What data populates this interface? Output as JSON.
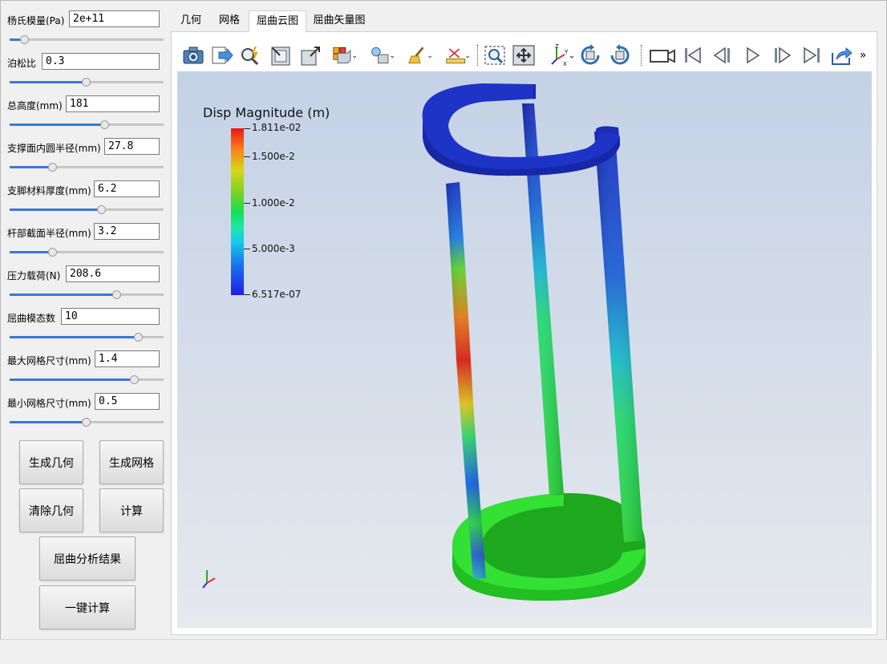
{
  "params": [
    {
      "label": "杨氏模量(Pa)",
      "value": "2e+11",
      "slider": 0.1
    },
    {
      "label": "泊松比",
      "value": "0.3",
      "slider": 0.5
    },
    {
      "label": "总高度(mm)",
      "value": "181",
      "slider": 0.62
    },
    {
      "label": "支撑面内圆半径(mm)",
      "value": "27.8",
      "slider": 0.28
    },
    {
      "label": "支脚材料厚度(mm)",
      "value": "6.2",
      "slider": 0.6
    },
    {
      "label": "杆部截面半径(mm)",
      "value": "3.2",
      "slider": 0.28
    },
    {
      "label": "压力载荷(N)",
      "value": "208.6",
      "slider": 0.7
    },
    {
      "label": "屈曲模态数",
      "value": "10",
      "slider": 0.84
    },
    {
      "label": "最大网格尺寸(mm)",
      "value": "1.4",
      "slider": 0.81
    },
    {
      "label": "最小网格尺寸(mm)",
      "value": "0.5",
      "slider": 0.5
    }
  ],
  "buttons": {
    "gen_geometry": "生成几何",
    "gen_mesh": "生成网格",
    "clear_geometry": "清除几何",
    "compute": "计算",
    "buckling_result": "屈曲分析结果",
    "one_click": "一键计算"
  },
  "tabs": [
    {
      "label": "几何",
      "active": false
    },
    {
      "label": "网格",
      "active": false
    },
    {
      "label": "屈曲云图",
      "active": true
    },
    {
      "label": "屈曲矢量图",
      "active": false
    }
  ],
  "toolbar": {
    "icons": [
      "camera-icon",
      "export-icon",
      "query-icon",
      "reset-camera-icon",
      "zoom-to-box-icon",
      "toggle-view-icon",
      "light-icon",
      "clear-icon",
      "ruler-icon",
      "zoom-select-icon",
      "fit-icon",
      "axes-icon",
      "rotate-ccw-icon",
      "rotate-cw-icon",
      "record-icon",
      "first-frame-icon",
      "prev-frame-icon",
      "play-icon",
      "next-frame-icon",
      "last-frame-icon",
      "save-icon"
    ],
    "overflow": "»",
    "axis_text": {
      "z": "Z",
      "y": "Y",
      "x": "X"
    }
  },
  "legend": {
    "title": "Disp Magnitude (m)",
    "labels": [
      "1.811e-02",
      "1.500e-2",
      "1.000e-2",
      "5.000e-3",
      "6.517e-07"
    ],
    "colors": {
      "max": "#e8161b",
      "mid": "#14e052",
      "min": "#1c1fe6"
    }
  },
  "viewport": {
    "background_top": "#c4d2e6",
    "background_bottom": "#e6e9ee",
    "top_ring_color": "#1a31c9",
    "bottom_ring_color": "#2bd82b"
  }
}
